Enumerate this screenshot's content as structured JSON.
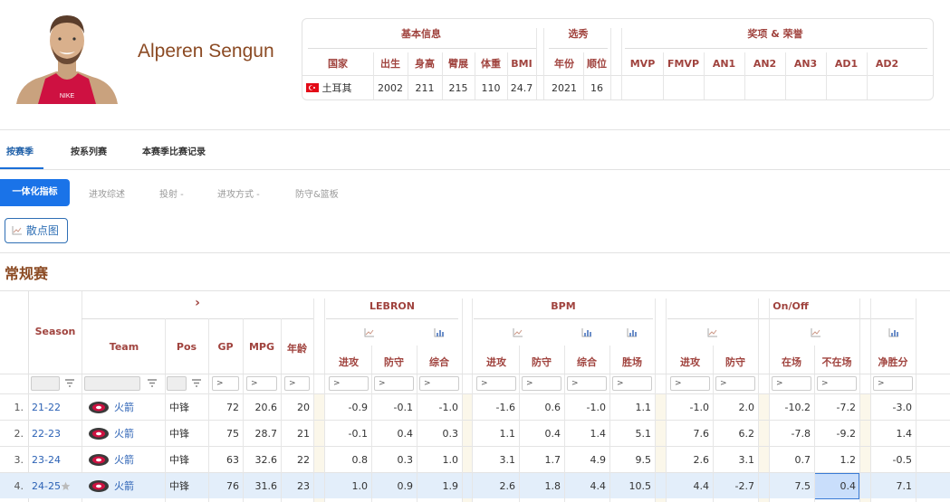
{
  "player": {
    "name": "Alperen Sengun"
  },
  "info": {
    "group_basic": "基本信息",
    "group_draft": "选秀",
    "group_awards": "奖项 & 荣誉",
    "headers": [
      "国家",
      "出生",
      "身高",
      "臂展",
      "体重",
      "BMI",
      "年份",
      "顺位",
      "MVP",
      "FMVP",
      "AN1",
      "AN2",
      "AN3",
      "AD1",
      "AD2"
    ],
    "values": {
      "country": "土耳其",
      "birth": "2002",
      "height": "211",
      "wingspan": "215",
      "weight": "110",
      "bmi": "24.7",
      "draft_year": "2021",
      "draft_pick": "16"
    }
  },
  "tabs": {
    "by_season": "按赛季",
    "by_series": "按系列赛",
    "season_games": "本赛季比赛记录"
  },
  "subtabs": {
    "integrated": "一体化指标",
    "offense_overview": "进攻综述",
    "shooting": "投射 -",
    "offense_type": "进攻方式 -",
    "defense_rebound": "防守&篮板"
  },
  "scatter_button": "散点图",
  "section_title": "常规赛",
  "table": {
    "season_header": "Season",
    "arrow": "›",
    "group_lebron": "LEBRON",
    "group_bpm": "BPM",
    "group_onoff": "On/Off",
    "col_team": "Team",
    "col_pos": "Pos",
    "col_gp": "GP",
    "col_mpg": "MPG",
    "col_age": "年龄",
    "lebron_cols": [
      "进攻",
      "防守",
      "综合"
    ],
    "bpm_cols": [
      "进攻",
      "防守",
      "综合",
      "胜场"
    ],
    "onoff_cols": [
      "进攻",
      "防守",
      "在场",
      "不在场",
      "净胜分"
    ],
    "filter_symbol": ">",
    "rows": [
      {
        "idx": "1.",
        "season": "21-22",
        "team": "火箭",
        "pos": "中锋",
        "gp": "72",
        "mpg": "20.6",
        "age": "20",
        "l_off": "-0.9",
        "l_def": "-0.1",
        "l_tot": "-1.0",
        "b_off": "-1.6",
        "b_def": "0.6",
        "b_tot": "-1.0",
        "b_win": "1.1",
        "o_off": "-1.0",
        "o_def": "2.0",
        "o_on": "-10.2",
        "o_offc": "-7.2",
        "o_net": "-3.0"
      },
      {
        "idx": "2.",
        "season": "22-23",
        "team": "火箭",
        "pos": "中锋",
        "gp": "75",
        "mpg": "28.7",
        "age": "21",
        "l_off": "-0.1",
        "l_def": "0.4",
        "l_tot": "0.3",
        "b_off": "1.1",
        "b_def": "0.4",
        "b_tot": "1.4",
        "b_win": "5.1",
        "o_off": "7.6",
        "o_def": "6.2",
        "o_on": "-7.8",
        "o_offc": "-9.2",
        "o_net": "1.4"
      },
      {
        "idx": "3.",
        "season": "23-24",
        "team": "火箭",
        "pos": "中锋",
        "gp": "63",
        "mpg": "32.6",
        "age": "22",
        "l_off": "0.8",
        "l_def": "0.3",
        "l_tot": "1.0",
        "b_off": "3.1",
        "b_def": "1.7",
        "b_tot": "4.9",
        "b_win": "9.5",
        "o_off": "2.6",
        "o_def": "3.1",
        "o_on": "0.7",
        "o_offc": "1.2",
        "o_net": "-0.5"
      },
      {
        "idx": "4.",
        "season": "24-25",
        "team": "火箭",
        "pos": "中锋",
        "gp": "76",
        "mpg": "31.6",
        "age": "23",
        "l_off": "1.0",
        "l_def": "0.9",
        "l_tot": "1.9",
        "b_off": "2.6",
        "b_def": "1.8",
        "b_tot": "4.4",
        "b_win": "10.5",
        "o_off": "4.4",
        "o_def": "-2.7",
        "o_on": "7.5",
        "o_offc": "0.4",
        "o_net": "7.1"
      }
    ]
  },
  "colors": {
    "accent": "#1a73e8",
    "header_text": "#a0433e",
    "name": "#8b4a23",
    "link": "#2c62b5",
    "highlight": "#e3eefa"
  }
}
